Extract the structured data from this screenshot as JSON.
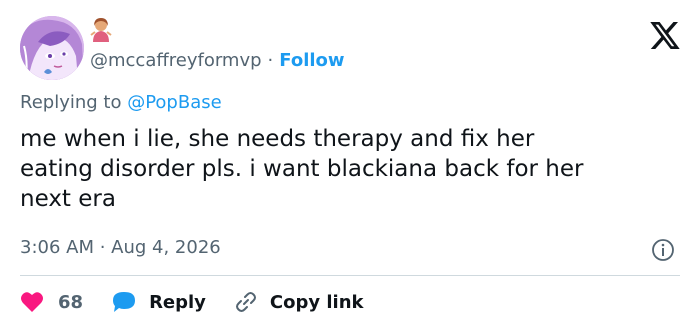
{
  "author": {
    "handle": "@mccaffreyformvp",
    "separator": "·",
    "follow_label": "Follow",
    "avatar_icon": "anime-character-avatar",
    "badge_emoji": "🤷‍♀️"
  },
  "reply_context": {
    "prefix": "Replying to ",
    "mention": "@PopBase"
  },
  "tweet": {
    "text": "me when i lie, she needs therapy and fix her\neating disorder pls. i want blackiana back for her\nnext era",
    "timestamp": "3:06 AM · Aug 4, 2026"
  },
  "actions": {
    "like_count": "68",
    "reply_label": "Reply",
    "copy_link_label": "Copy link"
  },
  "colors": {
    "accent": "#1d9bf0",
    "like": "#f91880",
    "muted": "#536471",
    "text": "#0f1419"
  }
}
